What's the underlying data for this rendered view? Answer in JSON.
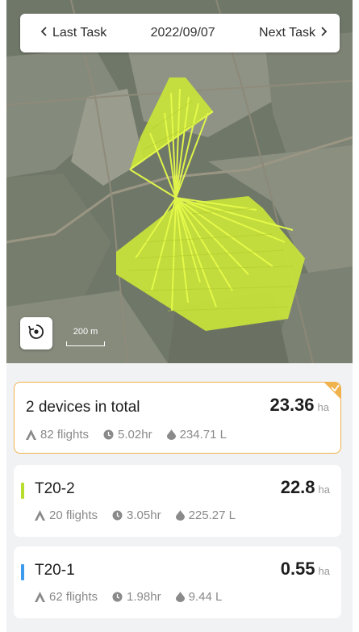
{
  "header": {
    "prev_label": "Last Task",
    "date": "2022/09/07",
    "next_label": "Next Task",
    "prev_icon": "chevron-left-icon",
    "next_icon": "chevron-right-icon"
  },
  "map": {
    "scale_label": "200 m",
    "recenter_icon": "recenter-icon",
    "route_color": "#d6f12f",
    "field_color": "#c9e43a"
  },
  "summary": {
    "title": "2 devices in total",
    "area": "23.36",
    "area_unit": "ha",
    "flights": "82 flights",
    "duration": "5.02hr",
    "volume": "234.71 L",
    "accent_color": "#f0b24d",
    "selected_icon": "check-icon"
  },
  "devices": [
    {
      "name": "T20-2",
      "area": "22.8",
      "area_unit": "ha",
      "flights": "20 flights",
      "duration": "3.05hr",
      "volume": "225.27 L",
      "color": "#b7dd2f"
    },
    {
      "name": "T20-1",
      "area": "0.55",
      "area_unit": "ha",
      "flights": "62 flights",
      "duration": "1.98hr",
      "volume": "9.44 L",
      "color": "#3c9bea"
    }
  ]
}
